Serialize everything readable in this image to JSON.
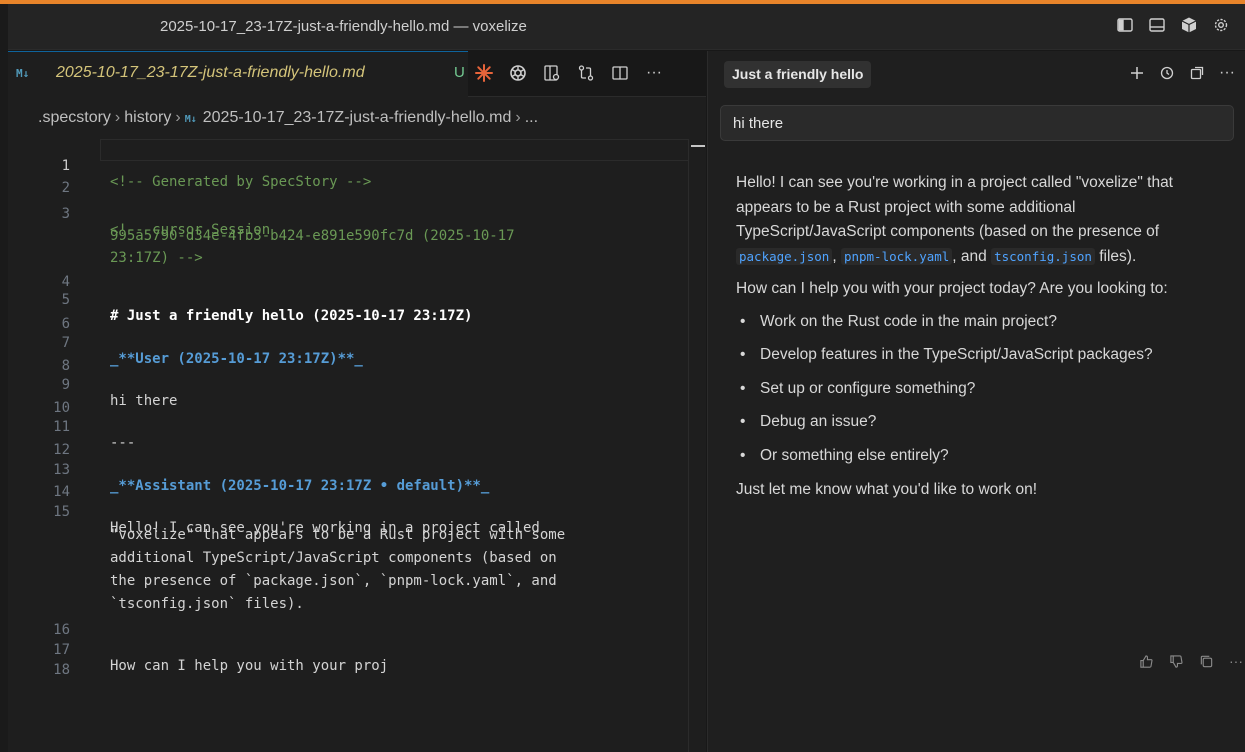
{
  "window": {
    "title": "2025-10-17_23-17Z-just-a-friendly-hello.md — voxelize",
    "icons": [
      "panel-left-icon",
      "panel-bottom-icon",
      "extension-cube-icon",
      "gear-icon"
    ]
  },
  "editor": {
    "tab": {
      "file_badge": "M↓",
      "name": "2025-10-17_23-17Z-just-a-friendly-hello.md",
      "status": "U"
    },
    "tab_actions": [
      "sparkle-icon",
      "openai-icon",
      "preview-icon",
      "git-compare-icon",
      "split-editor-icon",
      "more-icon"
    ],
    "breadcrumb": [
      ".specstory",
      "history",
      "2025-10-17_23-17Z-just-a-friendly-hello.md",
      "..."
    ],
    "breadcrumb_badge": "M↓",
    "lines": [
      {
        "num": "1",
        "text": "<!-- Generated by SpecStory -->"
      },
      {
        "num": "2",
        "text": ""
      },
      {
        "num": "3",
        "text": "<!-- cursor Session"
      },
      {
        "num": "",
        "text": "995a5790-d34e-4fb3-b424-e891e590fc7d (2025-10-17"
      },
      {
        "num": "",
        "text": "23:17Z) -->"
      },
      {
        "num": "4",
        "text": ""
      },
      {
        "num": "5",
        "text": "# Just a friendly hello (2025-10-17 23:17Z)"
      },
      {
        "num": "6",
        "text": ""
      },
      {
        "num": "7",
        "text": "_**User (2025-10-17 23:17Z)**_"
      },
      {
        "num": "8",
        "text": ""
      },
      {
        "num": "9",
        "text": "hi there"
      },
      {
        "num": "10",
        "text": ""
      },
      {
        "num": "11",
        "text": "---"
      },
      {
        "num": "12",
        "text": ""
      },
      {
        "num": "13",
        "text": "_**Assistant (2025-10-17 23:17Z • default)**_"
      },
      {
        "num": "14",
        "text": ""
      },
      {
        "num": "15",
        "text": "Hello! I can see you're working in a project called"
      },
      {
        "num": "",
        "text": "\"voxelize\" that appears to be a Rust project with some"
      },
      {
        "num": "",
        "text": "additional TypeScript/JavaScript components (based on"
      },
      {
        "num": "",
        "text": "the presence of `package.json`, `pnpm-lock.yaml`, and"
      },
      {
        "num": "",
        "text": "`tsconfig.json` files)."
      },
      {
        "num": "16",
        "text": ""
      },
      {
        "num": "17",
        "text": "How can I help you with your proj"
      },
      {
        "num": "18",
        "text": ""
      }
    ]
  },
  "chat": {
    "title": "Just a friendly hello",
    "actions": [
      "plus-icon",
      "history-icon",
      "open-in-editor-icon",
      "more-icon"
    ],
    "user_message": "hi there",
    "response": {
      "p1_a": "Hello! I can see you're working in a project called \"voxelize\" that appears to be a Rust project with some additional TypeScript/JavaScript components (based on the presence of ",
      "code1": "package.json",
      "sep1": ", ",
      "code2": "pnpm-lock.yaml",
      "sep2": ", and ",
      "code3": "tsconfig.json",
      "p1_b": " files).",
      "p2": "How can I help you with your project today? Are you looking to:",
      "bullets": [
        "Work on the Rust code in the main project?",
        "Develop features in the TypeScript/JavaScript packages?",
        "Set up or configure something?",
        "Debug an issue?",
        "Or something else entirely?"
      ],
      "p3": "Just let me know what you'd like to work on!"
    },
    "feedback": [
      "thumbs-up-icon",
      "thumbs-down-icon",
      "copy-icon",
      "more-icon"
    ]
  },
  "colors": {
    "accent_top": "#e8842a",
    "comment": "#6a9955",
    "keyword_blue": "#569cd6",
    "code_string": "#ce9178",
    "inline_code": "#4fa3ff",
    "tab_name": "#d4c47a",
    "untracked": "#73c991"
  }
}
